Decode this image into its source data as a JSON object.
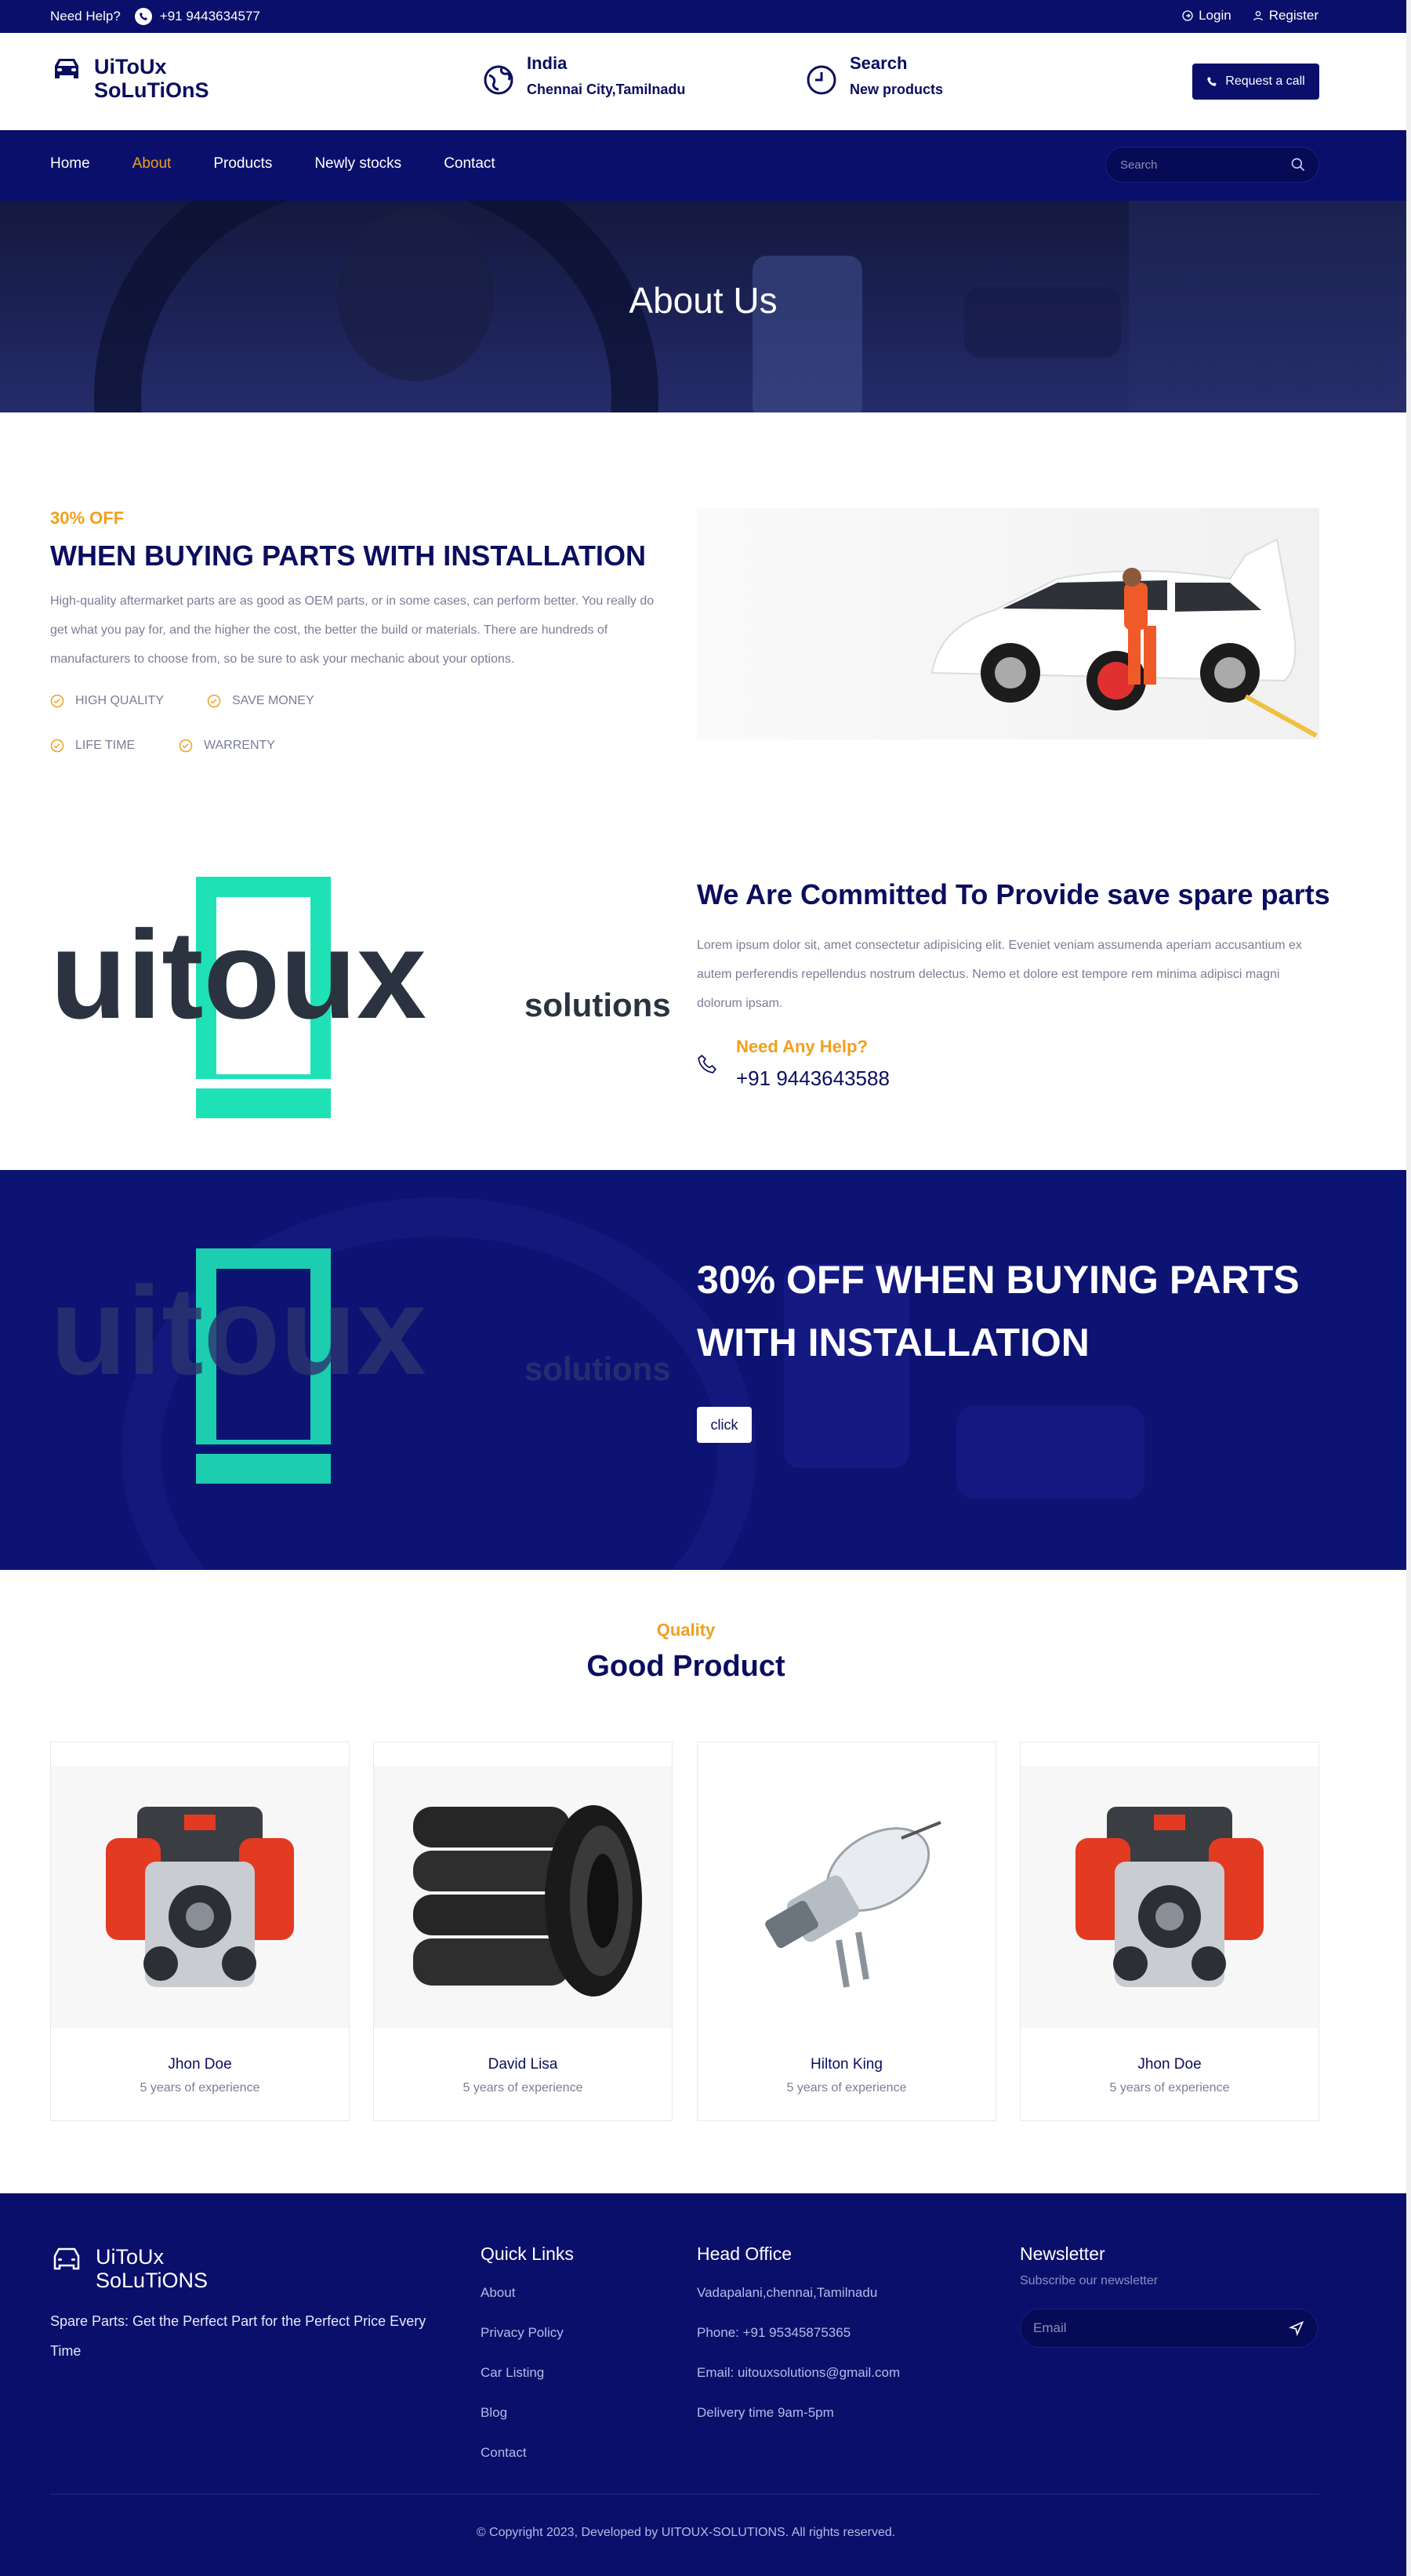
{
  "topbar": {
    "help_label": "Need Help?",
    "phone": "+91 9443634577",
    "login": "Login",
    "register": "Register"
  },
  "header": {
    "brand_line1": "UiToUx",
    "brand_line2": "SoLuTiOnS",
    "location_title": "India",
    "location_sub": "Chennai City,Tamilnadu",
    "search_title": "Search",
    "search_sub": "New products",
    "request_button": "Request a call"
  },
  "nav": {
    "items": [
      "Home",
      "About",
      "Products",
      "Newly stocks",
      "Contact"
    ],
    "active": "About",
    "search_placeholder": "Search"
  },
  "banner": {
    "title": "About Us"
  },
  "offer": {
    "tag": "30% OFF",
    "title": "WHEN BUYING PARTS WITH INSTALLATION",
    "description": "High-quality aftermarket parts are as good as OEM parts, or in some cases, can perform better. You really do get what you pay for, and the higher the cost, the better the build or materials. There are hundreds of manufacturers to choose from, so be sure to ask your mechanic about your options.",
    "features": [
      "HIGH QUALITY",
      "SAVE MONEY",
      "LIFE TIME",
      "WARRENTY"
    ]
  },
  "commit": {
    "logo_text": "uitoux",
    "logo_sub": "solutions",
    "title": "We Are Committed To Provide save spare parts",
    "description": "Lorem ipsum dolor sit, amet consectetur adipisicing elit. Eveniet veniam assumenda aperiam accusantium ex autem perferendis repellendus nostrum delectus. Nemo et dolore est tempore rem minima adipisci magni dolorum ipsam.",
    "help_label": "Need Any Help?",
    "help_phone": "+91 9443643588"
  },
  "promo": {
    "title": "30% OFF WHEN BUYING PARTS WITH INSTALLATION",
    "button": "click"
  },
  "products": {
    "tag": "Quality",
    "title": "Good Product",
    "items": [
      {
        "name": "Jhon Doe",
        "experience": "5 years of experience",
        "image": "engine"
      },
      {
        "name": "David Lisa",
        "experience": "5 years of experience",
        "image": "tires"
      },
      {
        "name": "Hilton King",
        "experience": "5 years of experience",
        "image": "headlight-bulb"
      },
      {
        "name": "Jhon Doe",
        "experience": "5 years of experience",
        "image": "engine"
      }
    ]
  },
  "footer": {
    "brand_line1": "UiToUx",
    "brand_line2": "SoLuTiONS",
    "tagline": "Spare Parts: Get the Perfect Part for the Perfect Price Every Time",
    "quick_links_title": "Quick Links",
    "quick_links": [
      "About",
      "Privacy Policy",
      "Car Listing",
      "Blog",
      "Contact"
    ],
    "head_office_title": "Head Office",
    "head_office": [
      "Vadapalani,chennai,Tamilnadu",
      "Phone: +91 95345875365",
      "Email: uitouxsolutions@gmail.com",
      "Delivery time 9am-5pm"
    ],
    "newsletter_title": "Newsletter",
    "newsletter_sub": "Subscribe our newsletter",
    "email_placeholder": "Email",
    "copyright": "Copyright 2023, Developed by UITOUX-SOLUTIONS. All rights reserved."
  },
  "colors": {
    "navy": "#0a0f6b",
    "accent": "#f0a020",
    "teal": "#1ee2b6"
  }
}
